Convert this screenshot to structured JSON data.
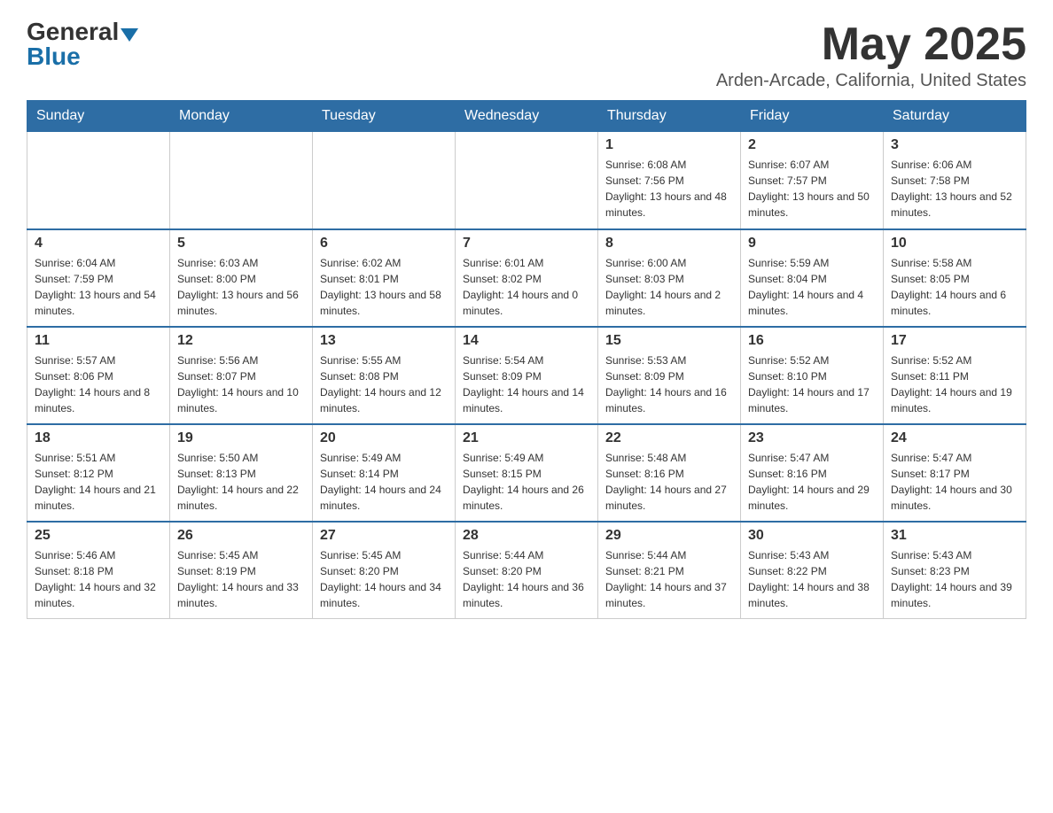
{
  "header": {
    "logo_main": "General",
    "logo_blue": "Blue",
    "month_title": "May 2025",
    "location": "Arden-Arcade, California, United States"
  },
  "days_of_week": [
    "Sunday",
    "Monday",
    "Tuesday",
    "Wednesday",
    "Thursday",
    "Friday",
    "Saturday"
  ],
  "weeks": [
    [
      {
        "day": "",
        "info": ""
      },
      {
        "day": "",
        "info": ""
      },
      {
        "day": "",
        "info": ""
      },
      {
        "day": "",
        "info": ""
      },
      {
        "day": "1",
        "info": "Sunrise: 6:08 AM\nSunset: 7:56 PM\nDaylight: 13 hours and 48 minutes."
      },
      {
        "day": "2",
        "info": "Sunrise: 6:07 AM\nSunset: 7:57 PM\nDaylight: 13 hours and 50 minutes."
      },
      {
        "day": "3",
        "info": "Sunrise: 6:06 AM\nSunset: 7:58 PM\nDaylight: 13 hours and 52 minutes."
      }
    ],
    [
      {
        "day": "4",
        "info": "Sunrise: 6:04 AM\nSunset: 7:59 PM\nDaylight: 13 hours and 54 minutes."
      },
      {
        "day": "5",
        "info": "Sunrise: 6:03 AM\nSunset: 8:00 PM\nDaylight: 13 hours and 56 minutes."
      },
      {
        "day": "6",
        "info": "Sunrise: 6:02 AM\nSunset: 8:01 PM\nDaylight: 13 hours and 58 minutes."
      },
      {
        "day": "7",
        "info": "Sunrise: 6:01 AM\nSunset: 8:02 PM\nDaylight: 14 hours and 0 minutes."
      },
      {
        "day": "8",
        "info": "Sunrise: 6:00 AM\nSunset: 8:03 PM\nDaylight: 14 hours and 2 minutes."
      },
      {
        "day": "9",
        "info": "Sunrise: 5:59 AM\nSunset: 8:04 PM\nDaylight: 14 hours and 4 minutes."
      },
      {
        "day": "10",
        "info": "Sunrise: 5:58 AM\nSunset: 8:05 PM\nDaylight: 14 hours and 6 minutes."
      }
    ],
    [
      {
        "day": "11",
        "info": "Sunrise: 5:57 AM\nSunset: 8:06 PM\nDaylight: 14 hours and 8 minutes."
      },
      {
        "day": "12",
        "info": "Sunrise: 5:56 AM\nSunset: 8:07 PM\nDaylight: 14 hours and 10 minutes."
      },
      {
        "day": "13",
        "info": "Sunrise: 5:55 AM\nSunset: 8:08 PM\nDaylight: 14 hours and 12 minutes."
      },
      {
        "day": "14",
        "info": "Sunrise: 5:54 AM\nSunset: 8:09 PM\nDaylight: 14 hours and 14 minutes."
      },
      {
        "day": "15",
        "info": "Sunrise: 5:53 AM\nSunset: 8:09 PM\nDaylight: 14 hours and 16 minutes."
      },
      {
        "day": "16",
        "info": "Sunrise: 5:52 AM\nSunset: 8:10 PM\nDaylight: 14 hours and 17 minutes."
      },
      {
        "day": "17",
        "info": "Sunrise: 5:52 AM\nSunset: 8:11 PM\nDaylight: 14 hours and 19 minutes."
      }
    ],
    [
      {
        "day": "18",
        "info": "Sunrise: 5:51 AM\nSunset: 8:12 PM\nDaylight: 14 hours and 21 minutes."
      },
      {
        "day": "19",
        "info": "Sunrise: 5:50 AM\nSunset: 8:13 PM\nDaylight: 14 hours and 22 minutes."
      },
      {
        "day": "20",
        "info": "Sunrise: 5:49 AM\nSunset: 8:14 PM\nDaylight: 14 hours and 24 minutes."
      },
      {
        "day": "21",
        "info": "Sunrise: 5:49 AM\nSunset: 8:15 PM\nDaylight: 14 hours and 26 minutes."
      },
      {
        "day": "22",
        "info": "Sunrise: 5:48 AM\nSunset: 8:16 PM\nDaylight: 14 hours and 27 minutes."
      },
      {
        "day": "23",
        "info": "Sunrise: 5:47 AM\nSunset: 8:16 PM\nDaylight: 14 hours and 29 minutes."
      },
      {
        "day": "24",
        "info": "Sunrise: 5:47 AM\nSunset: 8:17 PM\nDaylight: 14 hours and 30 minutes."
      }
    ],
    [
      {
        "day": "25",
        "info": "Sunrise: 5:46 AM\nSunset: 8:18 PM\nDaylight: 14 hours and 32 minutes."
      },
      {
        "day": "26",
        "info": "Sunrise: 5:45 AM\nSunset: 8:19 PM\nDaylight: 14 hours and 33 minutes."
      },
      {
        "day": "27",
        "info": "Sunrise: 5:45 AM\nSunset: 8:20 PM\nDaylight: 14 hours and 34 minutes."
      },
      {
        "day": "28",
        "info": "Sunrise: 5:44 AM\nSunset: 8:20 PM\nDaylight: 14 hours and 36 minutes."
      },
      {
        "day": "29",
        "info": "Sunrise: 5:44 AM\nSunset: 8:21 PM\nDaylight: 14 hours and 37 minutes."
      },
      {
        "day": "30",
        "info": "Sunrise: 5:43 AM\nSunset: 8:22 PM\nDaylight: 14 hours and 38 minutes."
      },
      {
        "day": "31",
        "info": "Sunrise: 5:43 AM\nSunset: 8:23 PM\nDaylight: 14 hours and 39 minutes."
      }
    ]
  ]
}
